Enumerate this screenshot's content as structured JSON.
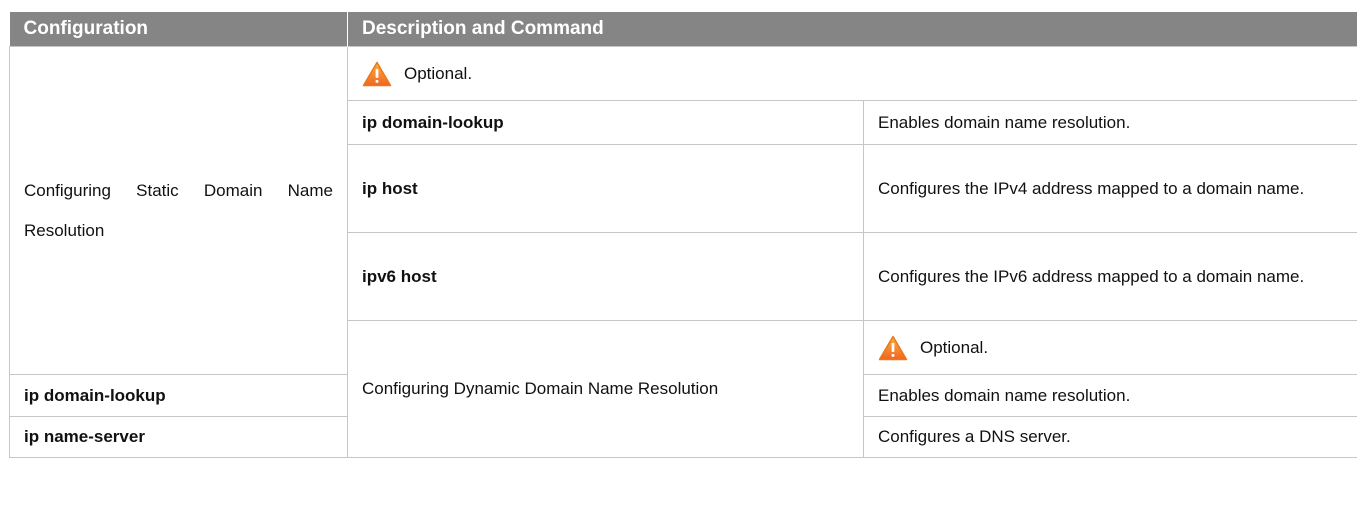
{
  "header": {
    "col_config": "Configuration",
    "col_desc": "Description and Command"
  },
  "sections": [
    {
      "config": "Configuring Static Domain Name Resolution",
      "note": "Optional.",
      "rows": [
        {
          "command": "ip domain-lookup",
          "description": "Enables domain name resolution."
        },
        {
          "command": "ip host",
          "description": "Configures the IPv4 address mapped to a domain name."
        },
        {
          "command": "ipv6 host",
          "description": "Configures the IPv6 address mapped to a domain name."
        }
      ]
    },
    {
      "config": "Configuring Dynamic Domain Name Resolution",
      "note": "Optional.",
      "rows": [
        {
          "command": "ip domain-lookup",
          "description": "Enables domain name resolution."
        },
        {
          "command": "ip name-server",
          "description": "Configures a DNS server."
        }
      ]
    }
  ],
  "icons": {
    "note_icon": "warning-icon",
    "warning_color": "#f7941d"
  }
}
